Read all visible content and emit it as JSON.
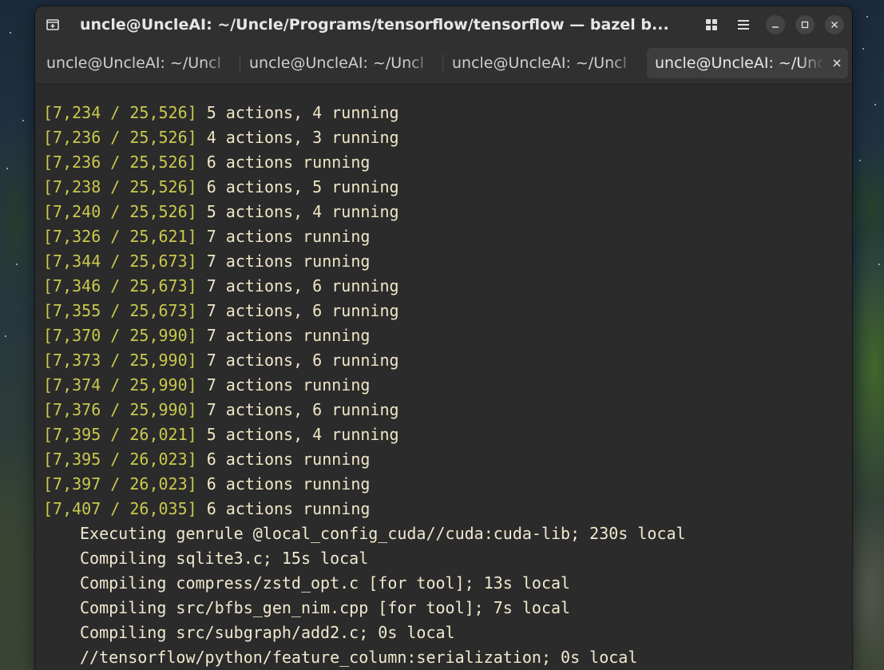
{
  "window": {
    "title": "uncle@UncleAI: ~/Uncle/Programs/tensorflow/tensorflow — bazel b..."
  },
  "headerbar": {
    "new_tab_icon": "new-tab-icon",
    "view_tabs_icon": "grid-icon",
    "menu_icon": "hamburger-menu-icon",
    "minimize_icon": "minimize-icon",
    "maximize_icon": "maximize-icon",
    "close_icon": "close-icon"
  },
  "tabs": [
    {
      "label": "uncle@UncleAI: ~/Uncl"
    },
    {
      "label": "uncle@UncleAI: ~/Uncl"
    },
    {
      "label": "uncle@UncleAI: ~/Uncl"
    },
    {
      "label": "uncle@UncleAI: ~/Uncl",
      "active": true
    }
  ],
  "terminal": {
    "progress_lines": [
      {
        "progress": "[7,234 / 25,526]",
        "message": "5 actions, 4 running"
      },
      {
        "progress": "[7,236 / 25,526]",
        "message": "4 actions, 3 running"
      },
      {
        "progress": "[7,236 / 25,526]",
        "message": "6 actions running"
      },
      {
        "progress": "[7,238 / 25,526]",
        "message": "6 actions, 5 running"
      },
      {
        "progress": "[7,240 / 25,526]",
        "message": "5 actions, 4 running"
      },
      {
        "progress": "[7,326 / 25,621]",
        "message": "7 actions running"
      },
      {
        "progress": "[7,344 / 25,673]",
        "message": "7 actions running"
      },
      {
        "progress": "[7,346 / 25,673]",
        "message": "7 actions, 6 running"
      },
      {
        "progress": "[7,355 / 25,673]",
        "message": "7 actions, 6 running"
      },
      {
        "progress": "[7,370 / 25,990]",
        "message": "7 actions running"
      },
      {
        "progress": "[7,373 / 25,990]",
        "message": "7 actions, 6 running"
      },
      {
        "progress": "[7,374 / 25,990]",
        "message": "7 actions running"
      },
      {
        "progress": "[7,376 / 25,990]",
        "message": "7 actions, 6 running"
      },
      {
        "progress": "[7,395 / 26,021]",
        "message": "5 actions, 4 running"
      },
      {
        "progress": "[7,395 / 26,023]",
        "message": "6 actions running"
      },
      {
        "progress": "[7,397 / 26,023]",
        "message": "6 actions running"
      },
      {
        "progress": "[7,407 / 26,035]",
        "message": "6 actions running"
      }
    ],
    "action_lines": [
      "Executing genrule @local_config_cuda//cuda:cuda-lib; 230s local",
      "Compiling sqlite3.c; 15s local",
      "Compiling compress/zstd_opt.c [for tool]; 13s local",
      "Compiling src/bfbs_gen_nim.cpp [for tool]; 7s local",
      "Compiling src/subgraph/add2.c; 0s local",
      "//tensorflow/python/feature_column:serialization; 0s local"
    ]
  }
}
